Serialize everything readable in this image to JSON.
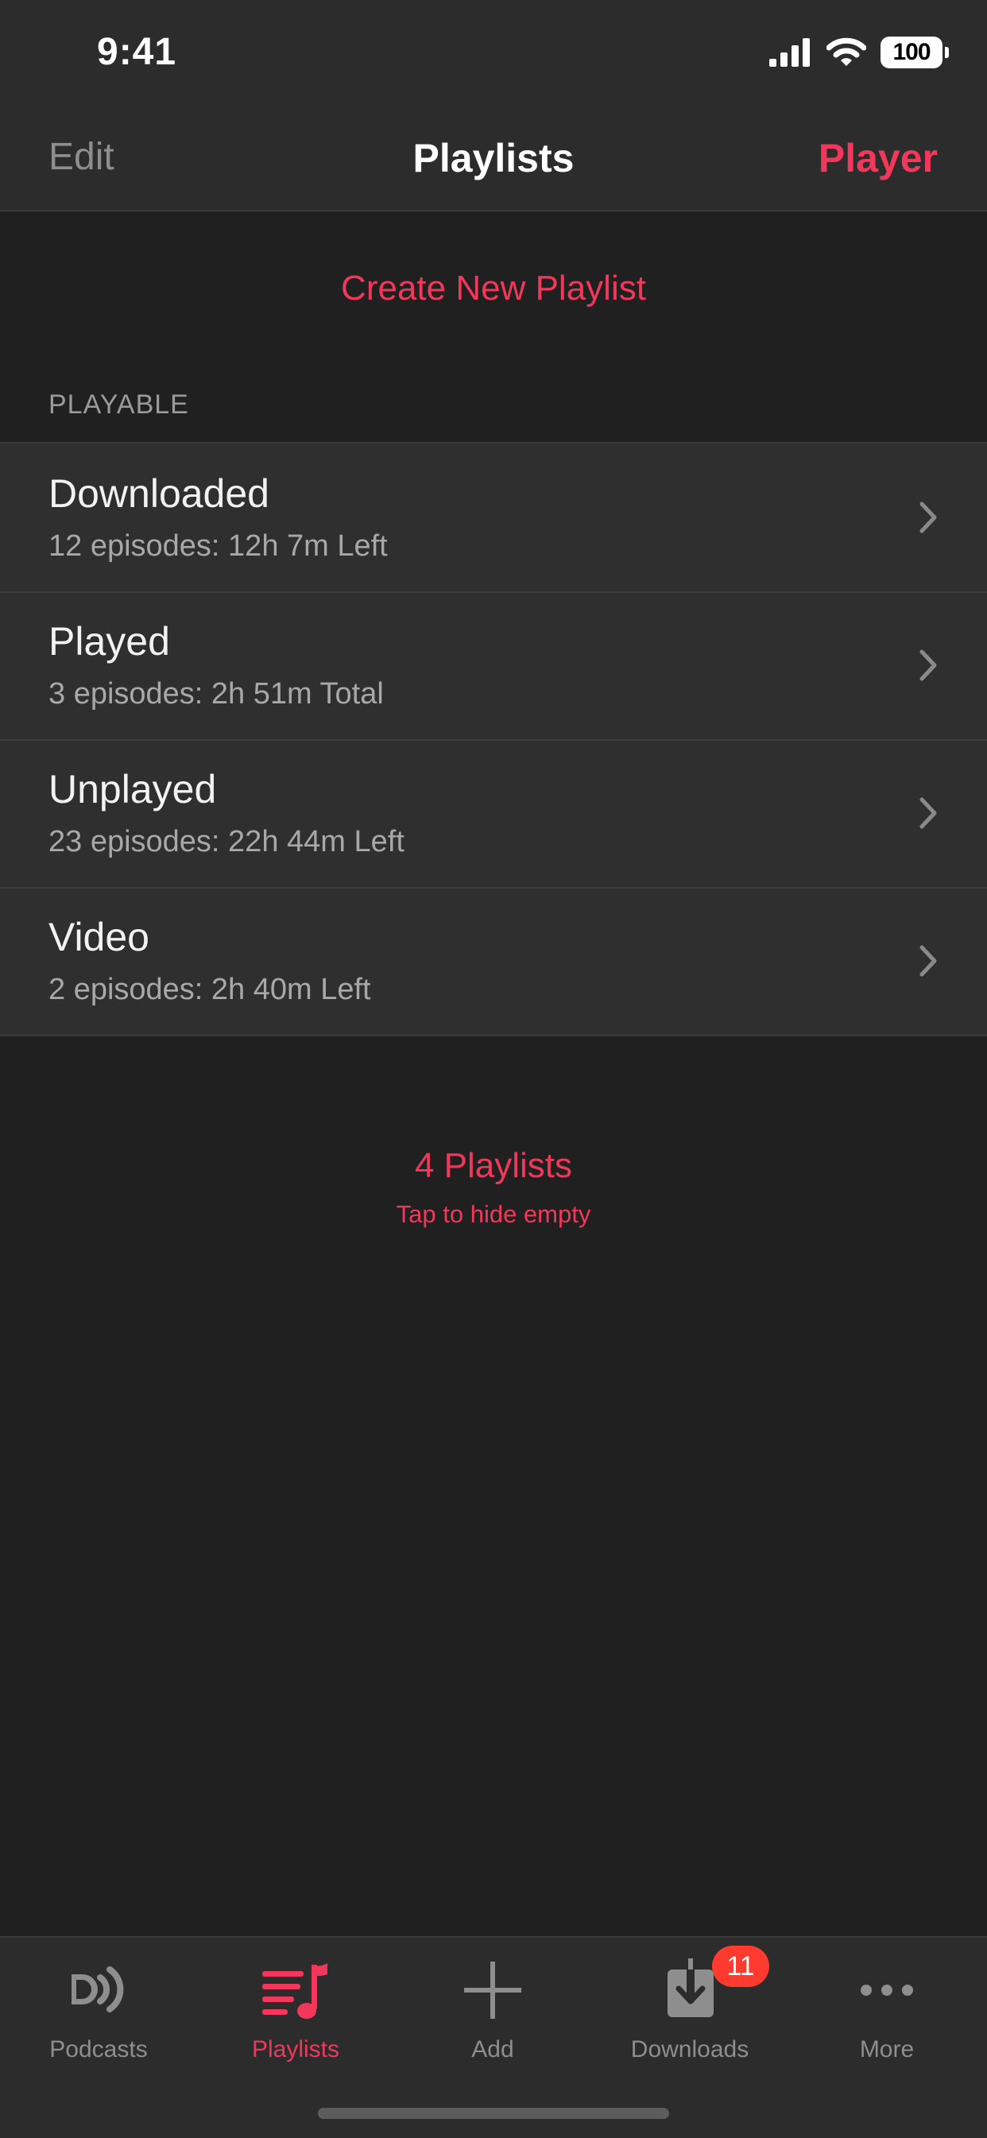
{
  "status_bar": {
    "time": "9:41",
    "battery": "100"
  },
  "nav": {
    "edit_label": "Edit",
    "title": "Playlists",
    "player_label": "Player"
  },
  "create_new_label": "Create New Playlist",
  "section_header": "PLAYABLE",
  "playlists": [
    {
      "title": "Downloaded",
      "subtitle": "12 episodes: 12h 7m Left"
    },
    {
      "title": "Played",
      "subtitle": "3 episodes: 2h 51m Total"
    },
    {
      "title": "Unplayed",
      "subtitle": "23 episodes: 22h 44m Left"
    },
    {
      "title": "Video",
      "subtitle": "2 episodes: 2h 40m Left"
    }
  ],
  "summary": {
    "count_label": "4 Playlists",
    "hint": "Tap to hide empty"
  },
  "tab_bar": {
    "tabs": [
      {
        "label": "Podcasts",
        "icon": "podcasts-icon",
        "active": false
      },
      {
        "label": "Playlists",
        "icon": "playlists-icon",
        "active": true
      },
      {
        "label": "Add",
        "icon": "plus-icon",
        "active": false
      },
      {
        "label": "Downloads",
        "icon": "download-icon",
        "active": false,
        "badge": "11"
      },
      {
        "label": "More",
        "icon": "ellipsis-icon",
        "active": false
      }
    ]
  },
  "colors": {
    "accent": "#f2385a",
    "background": "#202020",
    "bar": "#2c2c2c",
    "row": "#2f2f2f",
    "badge": "#ff3b30"
  }
}
